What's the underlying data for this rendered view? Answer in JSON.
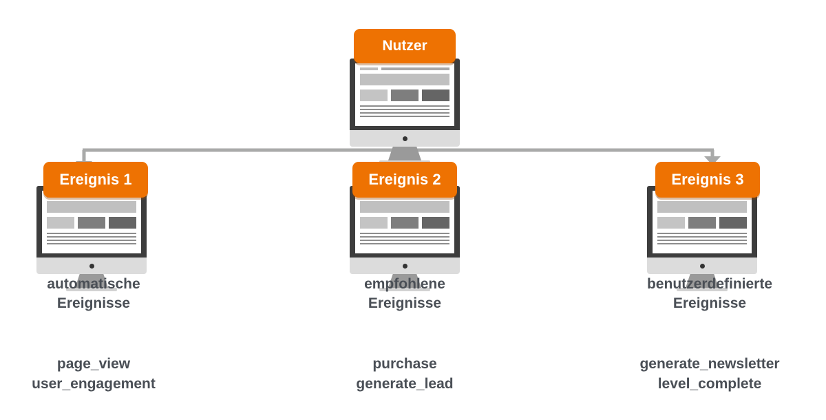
{
  "diagram": {
    "title_node": {
      "badge_label": "Nutzer",
      "icon": "desktop-monitor-icon"
    },
    "accent_color": "#ee7202",
    "text_color": "#4a4f56",
    "connector_color": "#a9aaa9",
    "branches": [
      {
        "badge_label": "Ereignis 1",
        "caption": "automatische\nEreignisse",
        "events": "page_view\nuser_engagement",
        "icon": "desktop-monitor-icon"
      },
      {
        "badge_label": "Ereignis 2",
        "caption": "empfohlene\nEreignisse",
        "events": "purchase\ngenerate_lead",
        "icon": "desktop-monitor-icon"
      },
      {
        "badge_label": "Ereignis 3",
        "caption": "benutzerdefinierte\nEreignisse",
        "events": "generate_newsletter\nlevel_complete",
        "icon": "desktop-monitor-icon"
      }
    ]
  }
}
